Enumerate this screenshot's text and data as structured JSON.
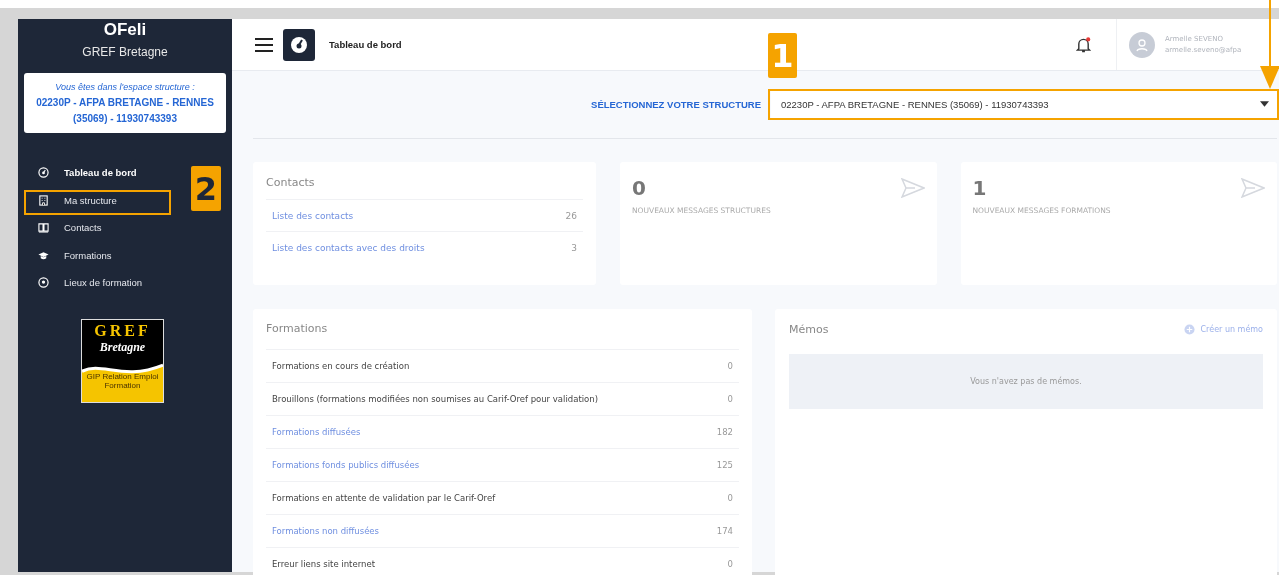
{
  "sidebar": {
    "app_name": "OFeli",
    "org_name": "GREF Bretagne",
    "context_box": {
      "intro": "Vous êtes dans l'espace structure :",
      "structure": "02230P - AFPA BRETAGNE - RENNES (35069) - 11930743393"
    },
    "items": [
      {
        "label": "Tableau de bord",
        "selected": true
      },
      {
        "label": "Ma structure",
        "selected": false
      },
      {
        "label": "Contacts",
        "selected": false
      },
      {
        "label": "Formations",
        "selected": false
      },
      {
        "label": "Lieux de formation",
        "selected": false
      }
    ],
    "logo": {
      "title": "GREF",
      "subtitle": "Bretagne",
      "caption": "GIP Relation Emploi Formation"
    }
  },
  "header": {
    "title": "Tableau de bord",
    "notification": true,
    "user": {
      "name": "Armelle SEVENO",
      "email": "armelle.seveno@afpa"
    }
  },
  "structure_select": {
    "label": "SÉLECTIONNEZ VOTRE STRUCTURE",
    "value": "02230P - AFPA BRETAGNE - RENNES (35069) - 11930743393"
  },
  "contacts_card": {
    "title": "Contacts",
    "rows": [
      {
        "label": "Liste des contacts",
        "count": "26",
        "kind": "link"
      },
      {
        "label": "Liste des contacts avec des droits",
        "count": "3",
        "kind": "link"
      }
    ]
  },
  "stat_cards": [
    {
      "value": "0",
      "label": "NOUVEAUX MESSAGES STRUCTURES"
    },
    {
      "value": "1",
      "label": "NOUVEAUX MESSAGES FORMATIONS"
    }
  ],
  "formations_card": {
    "title": "Formations",
    "rows": [
      {
        "label": "Formations en cours de création",
        "count": "0",
        "kind": "text"
      },
      {
        "label": "Brouillons (formations modifiées non soumises au Carif-Oref pour validation)",
        "count": "0",
        "kind": "text"
      },
      {
        "label": "Formations diffusées",
        "count": "182",
        "kind": "link"
      },
      {
        "label": "Formations fonds publics diffusées",
        "count": "125",
        "kind": "link"
      },
      {
        "label": "Formations en attente de validation par le Carif-Oref",
        "count": "0",
        "kind": "text"
      },
      {
        "label": "Formations non diffusées",
        "count": "174",
        "kind": "link"
      },
      {
        "label": "Erreur liens site internet",
        "count": "0",
        "kind": "text"
      }
    ]
  },
  "memos_card": {
    "title": "Mémos",
    "action": "Créer un mémo",
    "empty_message": "Vous n'avez pas de mémos."
  },
  "annotations": [
    {
      "number": "1"
    },
    {
      "number": "2"
    }
  ]
}
